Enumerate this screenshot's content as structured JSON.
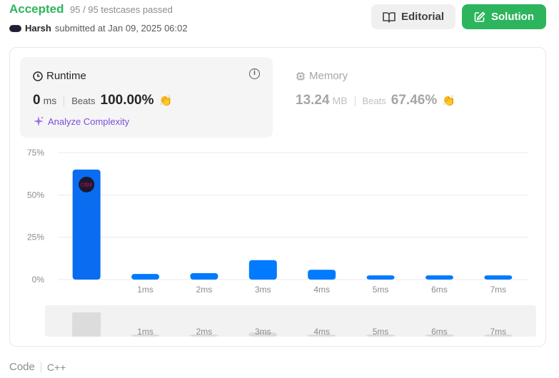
{
  "header": {
    "status": "Accepted",
    "testcases": "95 / 95 testcases passed",
    "username": "Harsh",
    "submitted_text": "submitted at Jan 09, 2025 06:02",
    "editorial_label": "Editorial",
    "solution_label": "Solution"
  },
  "runtime": {
    "title": "Runtime",
    "value": "0",
    "unit": "ms",
    "beats_label": "Beats",
    "beats_value": "100.00%",
    "analyze_label": "Analyze Complexity"
  },
  "memory": {
    "title": "Memory",
    "value": "13.24",
    "unit": "MB",
    "beats_label": "Beats",
    "beats_value": "67.46%"
  },
  "chart_data": {
    "type": "bar",
    "yticks": [
      "75%",
      "50%",
      "25%",
      "0%"
    ],
    "ylim": [
      0,
      75
    ],
    "categories": [
      "0ms",
      "1ms",
      "2ms",
      "3ms",
      "4ms",
      "5ms",
      "6ms",
      "7ms"
    ],
    "xtick_labels": [
      "",
      "1ms",
      "2ms",
      "3ms",
      "4ms",
      "5ms",
      "6ms",
      "7ms"
    ],
    "values": [
      65,
      3.3,
      3.8,
      11.5,
      5.8,
      2.5,
      2.5,
      2.5
    ],
    "highlight_index": 0,
    "marker_label": "CODE",
    "colors": {
      "bar": "#007aff",
      "highlight_bar": "#0a6cf0",
      "grid": "#ebebeb",
      "overview_bg": "#f2f2f2",
      "overview_bar": "#dcdcdc"
    },
    "grid": true
  },
  "footer": {
    "code_label": "Code",
    "language": "C++"
  },
  "colors": {
    "accent": "#2db55d",
    "purple": "#7c4dde"
  }
}
